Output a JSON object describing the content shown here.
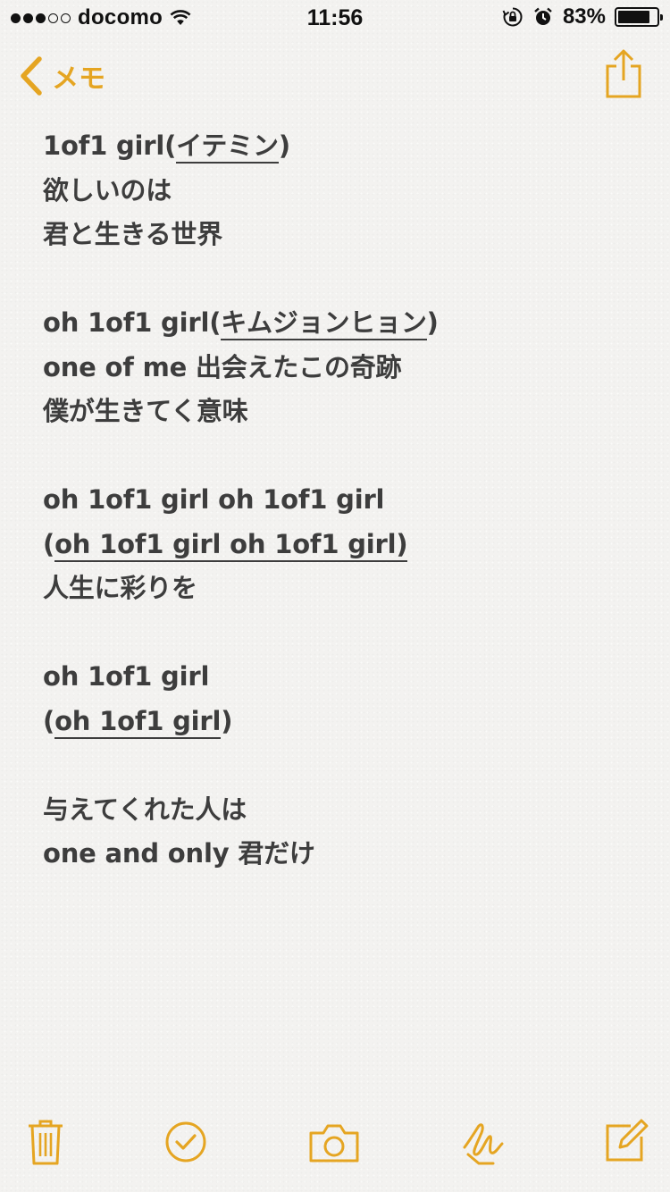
{
  "status_bar": {
    "carrier": "docomo",
    "signal_full": 3,
    "signal_total": 5,
    "time": "11:56",
    "battery_percent": "83%",
    "battery_level": 0.83
  },
  "nav": {
    "back_label": "メモ",
    "accent_color": "#e5a522"
  },
  "note": {
    "line1_a": "1of1 girl(",
    "line1_b": "イテミン",
    "line1_c": ")",
    "line2": "欲しいのは",
    "line3": "君と生きる世界",
    "line4_a": "oh 1of1 girl(",
    "line4_b": "キムジョンヒョン",
    "line4_c": ")",
    "line5": "one of me 出会えたこの奇跡",
    "line6": "僕が生きてく意味",
    "line7": "oh 1of1 girl oh 1of1 girl",
    "line8_a": "(",
    "line8_b": "oh 1of1 girl oh 1of1 girl)",
    "line9": "人生に彩りを",
    "line10": "oh 1of1 girl",
    "line11_a": "(",
    "line11_b": "oh 1of1 girl",
    "line11_c": ")",
    "line12": "与えてくれた人は",
    "line13": "one and only 君だけ"
  },
  "toolbar": {
    "icons": [
      "trash-icon",
      "checklist-icon",
      "camera-icon",
      "sketch-icon",
      "compose-icon"
    ]
  }
}
